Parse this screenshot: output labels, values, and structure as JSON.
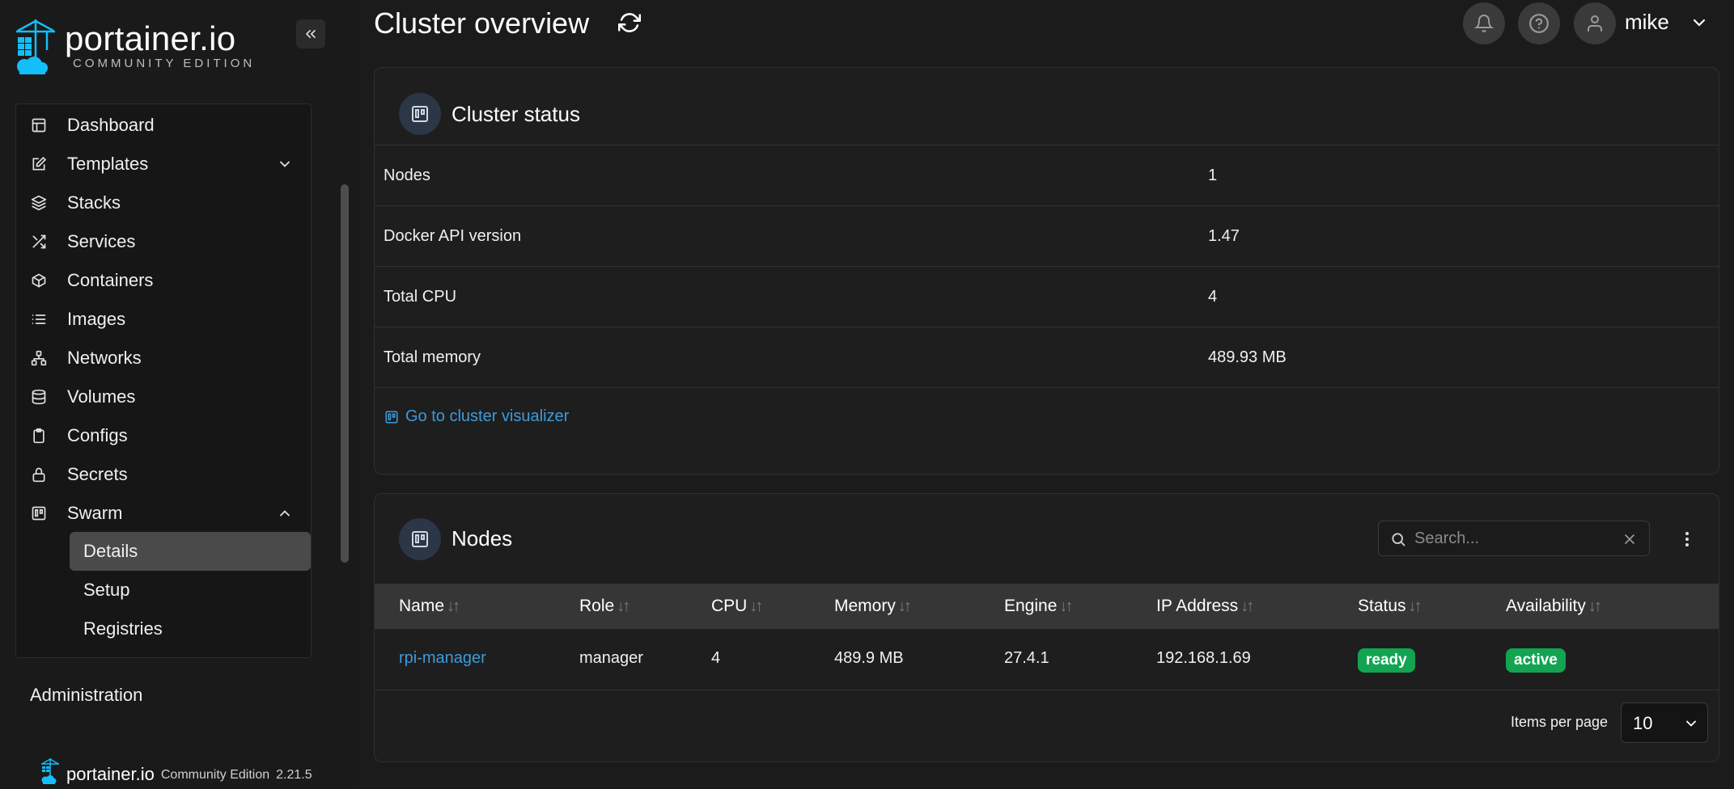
{
  "sidebar": {
    "brand": "portainer.io",
    "edition": "COMMUNITY EDITION",
    "menu": [
      {
        "label": "Dashboard",
        "icon": "dashboard-icon"
      },
      {
        "label": "Templates",
        "icon": "edit-icon"
      },
      {
        "label": "Stacks",
        "icon": "layers-icon"
      },
      {
        "label": "Services",
        "icon": "shuffle-icon"
      },
      {
        "label": "Containers",
        "icon": "box-icon"
      },
      {
        "label": "Images",
        "icon": "list-icon"
      },
      {
        "label": "Networks",
        "icon": "network-icon"
      },
      {
        "label": "Volumes",
        "icon": "database-icon"
      },
      {
        "label": "Configs",
        "icon": "clipboard-icon"
      },
      {
        "label": "Secrets",
        "icon": "lock-icon"
      },
      {
        "label": "Swarm",
        "icon": "trello-icon"
      }
    ],
    "swarm_sub": [
      {
        "label": "Details",
        "active": true
      },
      {
        "label": "Setup",
        "active": false
      },
      {
        "label": "Registries",
        "active": false
      }
    ],
    "administration": "Administration",
    "footer": {
      "brand": "portainer.io",
      "edition": "Community Edition",
      "version": "2.21.5"
    }
  },
  "header": {
    "title": "Cluster overview",
    "username": "mike"
  },
  "cluster_status": {
    "title": "Cluster status",
    "rows": [
      {
        "key": "Nodes",
        "value": "1"
      },
      {
        "key": "Docker API version",
        "value": "1.47"
      },
      {
        "key": "Total CPU",
        "value": "4"
      },
      {
        "key": "Total memory",
        "value": "489.93 MB"
      }
    ],
    "link_label": "Go to cluster visualizer"
  },
  "nodes": {
    "title": "Nodes",
    "search_placeholder": "Search...",
    "columns": [
      "Name",
      "Role",
      "CPU",
      "Memory",
      "Engine",
      "IP Address",
      "Status",
      "Availability"
    ],
    "rows": [
      {
        "name": "rpi-manager",
        "role": "manager",
        "cpu": "4",
        "memory": "489.9 MB",
        "engine": "27.4.1",
        "ip": "192.168.1.69",
        "status": "ready",
        "availability": "active"
      }
    ],
    "items_per_page_label": "Items per page",
    "items_per_page": "10"
  },
  "colors": {
    "accent_link": "#3f9ad8",
    "badge_green": "#13a452",
    "logo_blue": "#13bef9"
  }
}
